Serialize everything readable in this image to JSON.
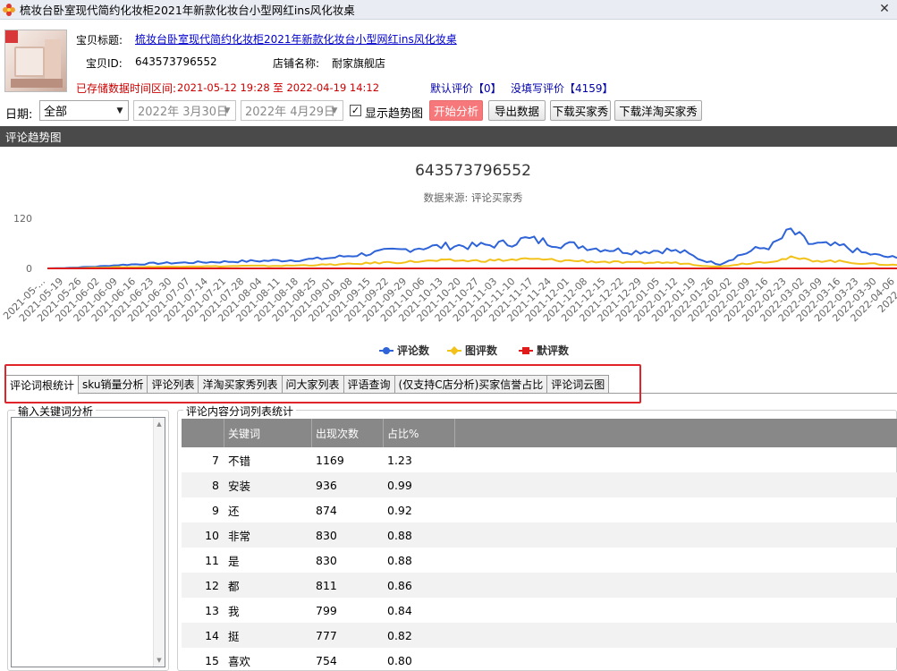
{
  "window": {
    "title": "梳妆台卧室现代简约化妆柜2021年新款化妆台小型网红ins风化妆桌",
    "close_icon": "close-icon"
  },
  "product": {
    "title_label": "宝贝标题:",
    "title_value": "梳妆台卧室现代简约化妆柜2021年新款化妆台小型网红ins风化妆桌",
    "id_label": "宝贝ID:",
    "id_value": "643573796552",
    "shop_label": "店铺名称:",
    "shop_value": "耐家旗舰店",
    "stored_range_label": "已存储数据时间区间:",
    "stored_range_value": "2021-05-12 19:28 至 2022-04-19 14:12",
    "default_reviews": "默认评价【0】",
    "unwritten_reviews": "没填写评价【4159】"
  },
  "toolbar": {
    "date_label": "日期:",
    "range_select": "全部",
    "start_date": "2022年 3月30日",
    "end_date": "2022年 4月29日",
    "show_trend_label": "显示趋势图",
    "show_trend_checked": true,
    "start_button": "开始分析",
    "export_button": "导出数据",
    "download_buyer_show": "下载买家秀",
    "download_overseas_show": "下载洋淘买家秀"
  },
  "section": {
    "trend_title": "评论趋势图"
  },
  "chart_data": {
    "type": "line",
    "title": "643573796552",
    "subtitle": "数据来源: 评论买家秀",
    "y_ticks": [
      "120",
      "0"
    ],
    "ylim": [
      0,
      120
    ],
    "x_tick_labels": [
      "2021-05-...",
      "2021-05-19",
      "2021-05-26",
      "2021-06-02",
      "2021-06-09",
      "2021-06-16",
      "2021-06-23",
      "2021-06-30",
      "2021-07-07",
      "2021-07-14",
      "2021-07-21",
      "2021-07-28",
      "2021-08-04",
      "2021-08-11",
      "2021-08-18",
      "2021-08-25",
      "2021-09-01",
      "2021-09-08",
      "2021-09-15",
      "2021-09-22",
      "2021-09-29",
      "2021-10-06",
      "2021-10-13",
      "2021-10-20",
      "2021-10-27",
      "2021-11-03",
      "2021-11-10",
      "2021-11-17",
      "2021-11-24",
      "2021-12-01",
      "2021-12-08",
      "2021-12-15",
      "2021-12-22",
      "2021-12-29",
      "2022-01-05",
      "2022-01-12",
      "2022-01-19",
      "2022-01-26",
      "2022-02-02",
      "2022-02-09",
      "2022-02-16",
      "2022-02-23",
      "2022-03-02",
      "2022-03-09",
      "2022-03-16",
      "2022-03-23",
      "2022-03-30",
      "2022-04-06",
      "2022-0..."
    ],
    "series": [
      {
        "name": "评论数",
        "color": "#2f63d8",
        "values": [
          0,
          1,
          3,
          5,
          8,
          10,
          12,
          13,
          14,
          15,
          16,
          17,
          18,
          19,
          20,
          22,
          25,
          30,
          35,
          40,
          44,
          50,
          52,
          55,
          53,
          56,
          60,
          70,
          65,
          58,
          55,
          48,
          45,
          40,
          42,
          44,
          38,
          20,
          10,
          30,
          45,
          55,
          90,
          60,
          55,
          52,
          38,
          30,
          25
        ]
      },
      {
        "name": "图评数",
        "color": "#f2c21b",
        "values": [
          0,
          0,
          1,
          2,
          3,
          3,
          4,
          4,
          5,
          5,
          5,
          6,
          6,
          6,
          7,
          8,
          9,
          10,
          12,
          14,
          15,
          17,
          18,
          19,
          18,
          19,
          20,
          22,
          21,
          19,
          18,
          16,
          15,
          13,
          14,
          14,
          12,
          7,
          4,
          10,
          14,
          18,
          25,
          20,
          18,
          16,
          12,
          10,
          8
        ]
      },
      {
        "name": "默评数",
        "color": "#e01b1b",
        "values": [
          0,
          0,
          0,
          0,
          0,
          0,
          0,
          0,
          0,
          0,
          0,
          0,
          0,
          0,
          0,
          0,
          0,
          0,
          0,
          0,
          0,
          0,
          0,
          0,
          0,
          0,
          0,
          0,
          0,
          0,
          0,
          0,
          0,
          0,
          0,
          0,
          0,
          0,
          0,
          0,
          0,
          0,
          0,
          0,
          0,
          0,
          0,
          0,
          0
        ]
      }
    ],
    "legend_position": "bottom"
  },
  "tabs": [
    {
      "label": "评论词根统计",
      "active": true
    },
    {
      "label": "sku销量分析"
    },
    {
      "label": "评论列表"
    },
    {
      "label": "洋淘买家秀列表"
    },
    {
      "label": "问大家列表"
    },
    {
      "label": "评语查询"
    },
    {
      "label": "(仅支持C店分析)买家信誉占比"
    },
    {
      "label": "评论词云图"
    }
  ],
  "left_panel": {
    "title": "输入关键词分析"
  },
  "right_panel": {
    "title": "评论内容分词列表统计",
    "columns": [
      "关键词",
      "出现次数",
      "占比%"
    ],
    "rows": [
      {
        "idx": "7",
        "keyword": "不错",
        "count": "1169",
        "pct": "1.23"
      },
      {
        "idx": "8",
        "keyword": "安装",
        "count": "936",
        "pct": "0.99"
      },
      {
        "idx": "9",
        "keyword": "还",
        "count": "874",
        "pct": "0.92"
      },
      {
        "idx": "10",
        "keyword": "非常",
        "count": "830",
        "pct": "0.88"
      },
      {
        "idx": "11",
        "keyword": "是",
        "count": "830",
        "pct": "0.88"
      },
      {
        "idx": "12",
        "keyword": "都",
        "count": "811",
        "pct": "0.86"
      },
      {
        "idx": "13",
        "keyword": "我",
        "count": "799",
        "pct": "0.84"
      },
      {
        "idx": "14",
        "keyword": "挺",
        "count": "777",
        "pct": "0.82"
      },
      {
        "idx": "15",
        "keyword": "喜欢",
        "count": "754",
        "pct": "0.80"
      }
    ]
  }
}
